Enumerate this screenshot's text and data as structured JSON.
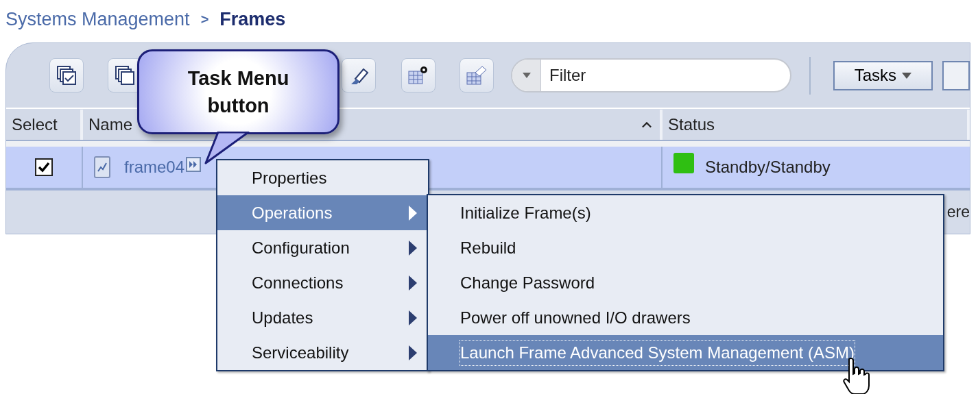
{
  "breadcrumb": {
    "parent": "Systems Management",
    "separator": ">",
    "current": "Frames"
  },
  "toolbar": {
    "filter": {
      "placeholder": "Filter"
    },
    "tasks_button": "Tasks"
  },
  "callout": {
    "text": "Task Menu button"
  },
  "table": {
    "columns": [
      {
        "label": "Select",
        "sorted": false
      },
      {
        "label": "Name",
        "sorted": true
      },
      {
        "label": "Status",
        "sorted": false
      }
    ],
    "rows": [
      {
        "selected": true,
        "checked": true,
        "name": "frame04",
        "status": "Standby/Standby",
        "color": "#2fbf12"
      }
    ],
    "footer_text": "ere"
  },
  "menu": {
    "items": [
      {
        "label": "Properties",
        "submenu": false,
        "selected": false
      },
      {
        "label": "Operations",
        "submenu": true,
        "selected": true
      },
      {
        "label": "Configuration",
        "submenu": true,
        "selected": false
      },
      {
        "label": "Connections",
        "submenu": true,
        "selected": false
      },
      {
        "label": "Updates",
        "submenu": true,
        "selected": false
      },
      {
        "label": "Serviceability",
        "submenu": true,
        "selected": false
      }
    ]
  },
  "submenu": {
    "items": [
      {
        "label": "Initialize Frame(s)",
        "selected": false
      },
      {
        "label": "Rebuild",
        "selected": false
      },
      {
        "label": "Change Password",
        "selected": false
      },
      {
        "label": "Power off unowned I/O drawers",
        "selected": false
      },
      {
        "label": "Launch Frame Advanced System Management (ASM)",
        "selected": true
      }
    ]
  }
}
